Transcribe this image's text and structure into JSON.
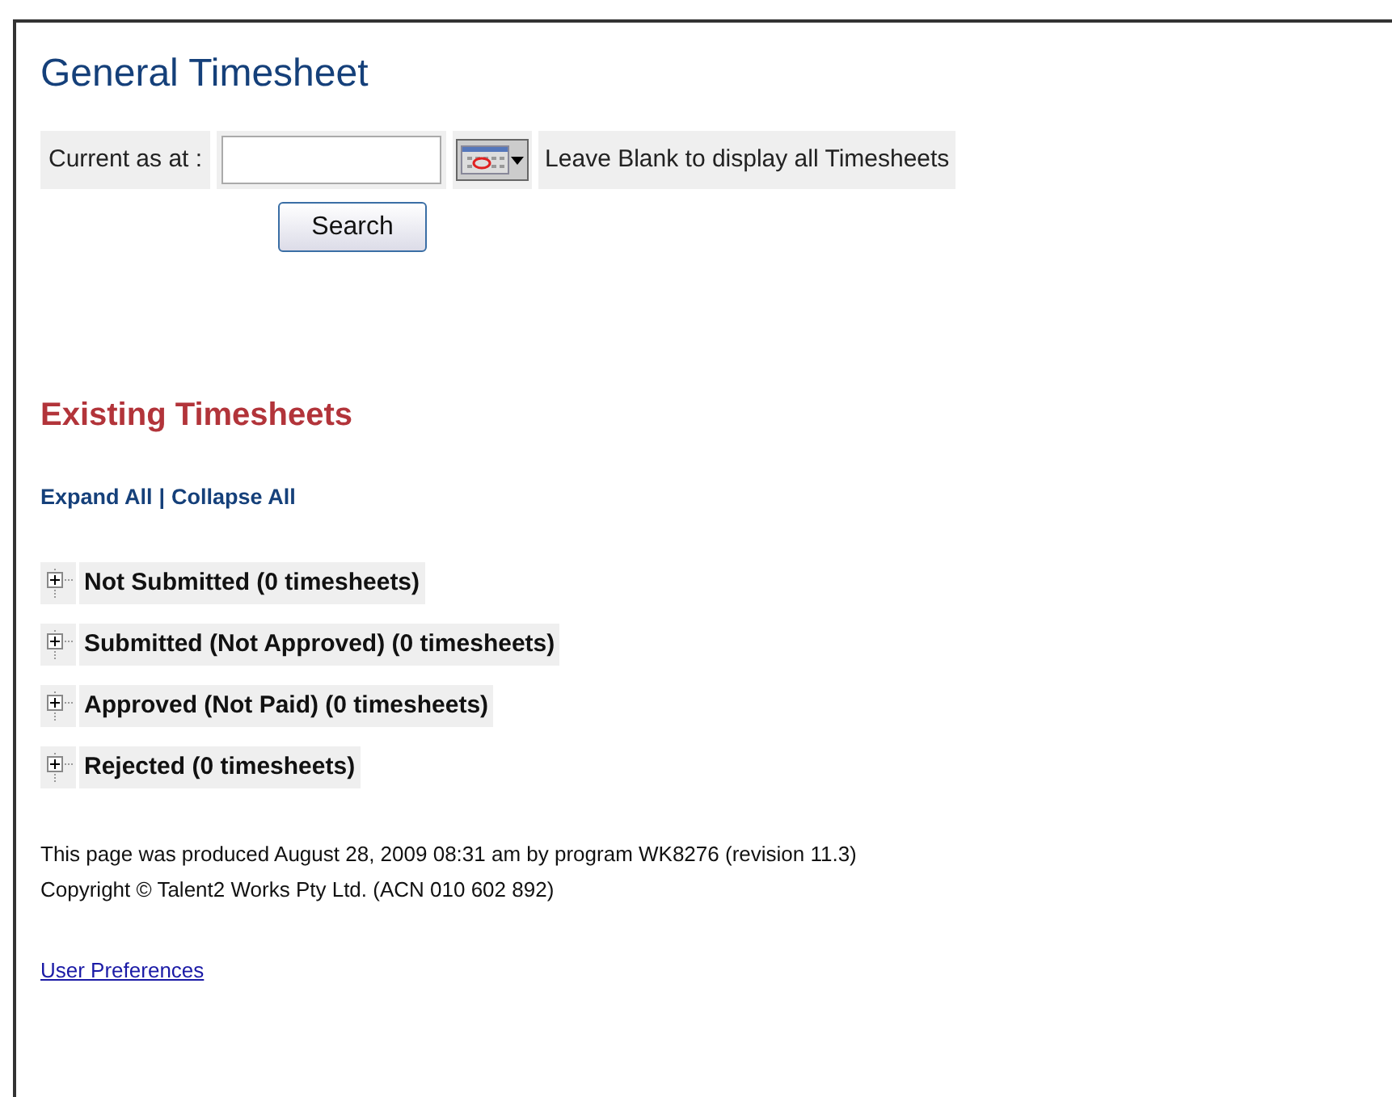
{
  "title": "General Timesheet",
  "filter": {
    "label": "Current as at :",
    "hint": "Leave Blank to display all Timesheets",
    "button": "Search"
  },
  "section_title": "Existing Timesheets",
  "links": {
    "expand": "Expand All",
    "separator": "|",
    "collapse": "Collapse All"
  },
  "groups": [
    {
      "label": "Not Submitted (0 timesheets)",
      "expanded": false
    },
    {
      "label": "Submitted (Not Approved) (0 timesheets)",
      "expanded": false
    },
    {
      "label": "Approved (Not Paid) (0 timesheets)",
      "expanded": false
    },
    {
      "label": "Rejected (0 timesheets)",
      "expanded": false
    }
  ],
  "footer": [
    "This page was produced August 28, 2009 08:31 am by program WK8276 (revision 11.3)",
    "Copyright © Talent2 Works Pty Ltd. (ACN 010 602 892)"
  ],
  "preferences_link": "User Preferences"
}
